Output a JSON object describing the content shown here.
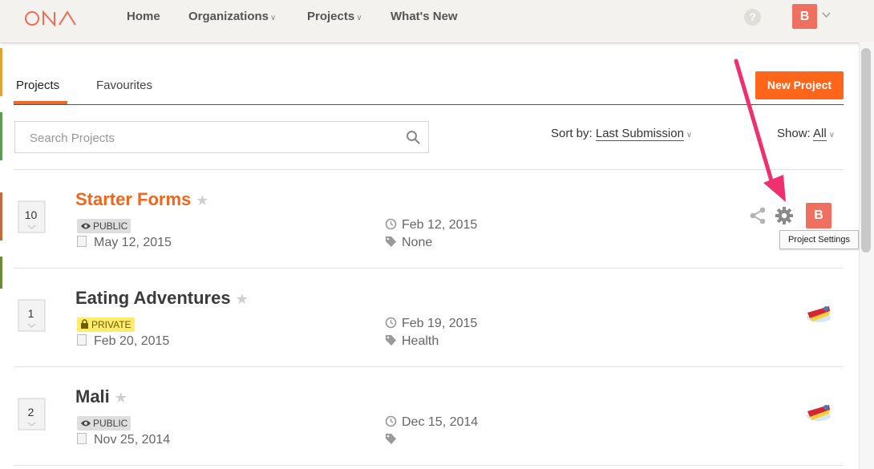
{
  "header": {
    "logo_text": "ONA",
    "nav": [
      {
        "label": "Home"
      },
      {
        "label": "Organizations"
      },
      {
        "label": "Projects"
      },
      {
        "label": "What's New"
      }
    ],
    "help_icon": "question-icon",
    "user_initial": "B"
  },
  "tabs": [
    {
      "label": "Projects",
      "active": true
    },
    {
      "label": "Favourites",
      "active": false
    }
  ],
  "new_project_label": "New Project",
  "search": {
    "placeholder": "Search Projects",
    "value": ""
  },
  "sort": {
    "label": "Sort by:",
    "value": "Last Submission"
  },
  "show": {
    "label": "Show:",
    "value": "All"
  },
  "projects": [
    {
      "count": "10",
      "title": "Starter Forms",
      "visibility": "PUBLIC",
      "date_created": "May 12, 2015",
      "last_submission": "Feb 12, 2015",
      "tags": "None",
      "member_initial": "B",
      "tooltip": "Project Settings"
    },
    {
      "count": "1",
      "title": "Eating Adventures",
      "visibility": "PRIVATE",
      "date_created": "Feb 20, 2015",
      "last_submission": "Feb 19, 2015",
      "tags": "Health"
    },
    {
      "count": "2",
      "title": "Mali",
      "visibility": "PUBLIC",
      "date_created": "Nov 25, 2014",
      "last_submission": "Dec 15, 2014",
      "tags": ""
    }
  ],
  "colors": {
    "accent": "#ff6619",
    "title_orange": "#f2651c",
    "arrow": "#f0306e",
    "user_badge": "#f0705f",
    "private_badge": "#ffec6a"
  }
}
